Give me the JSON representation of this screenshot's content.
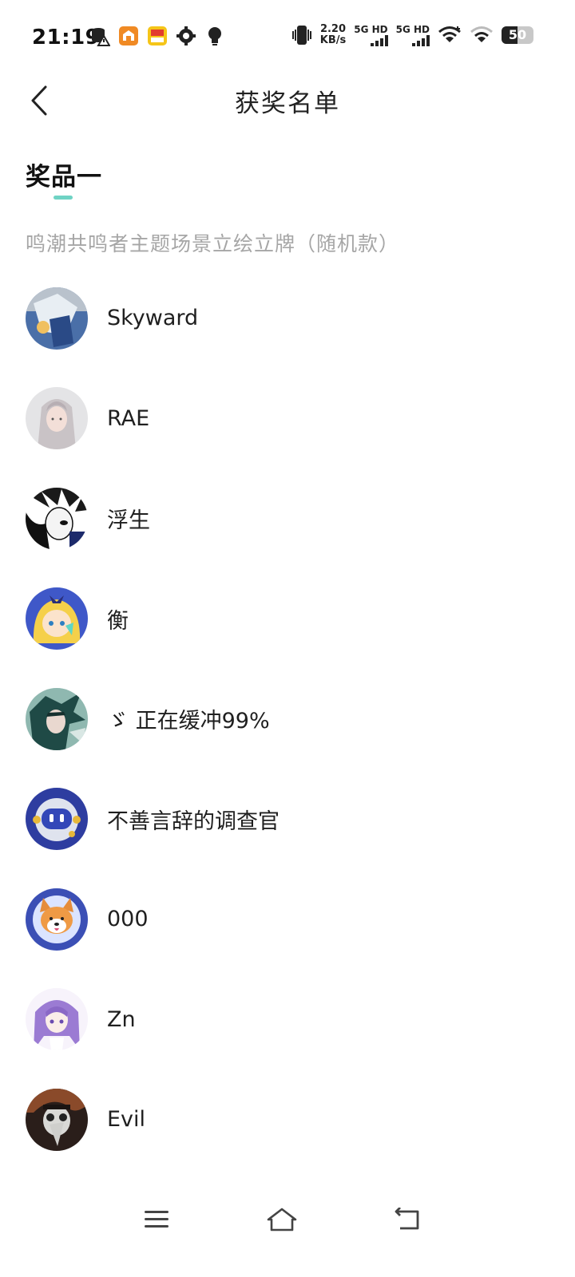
{
  "status_bar": {
    "time": "21:19",
    "net_speed_value": "2.20",
    "net_speed_unit": "KB/s",
    "sim1_label": "5G HD",
    "sim2_label": "5G HD",
    "battery_level": "50"
  },
  "header": {
    "title": "获奖名单"
  },
  "section": {
    "title": "奖品一",
    "prize_description": "鸣潮共鸣者主题场景立绘立牌（随机款）"
  },
  "winners": [
    {
      "name": "Skyward",
      "avatar": "avatar-blue-white-art"
    },
    {
      "name": "RAE",
      "avatar": "avatar-silver-hair-girl"
    },
    {
      "name": "浮生",
      "avatar": "avatar-monochrome-manga"
    },
    {
      "name": "衡",
      "avatar": "avatar-blonde-chibi"
    },
    {
      "name": "ゞ 正在缓冲99%",
      "avatar": "avatar-green-hair-character"
    },
    {
      "name": "不善言辞的调查官",
      "avatar": "avatar-robot-mascot"
    },
    {
      "name": "000",
      "avatar": "avatar-shiba-astronaut"
    },
    {
      "name": "Zn",
      "avatar": "avatar-purple-hair-anime"
    },
    {
      "name": "Evil",
      "avatar": "avatar-plague-doctor"
    }
  ],
  "colors": {
    "accent": "#6fd3c4",
    "secondary_text": "#a6a6a6"
  }
}
